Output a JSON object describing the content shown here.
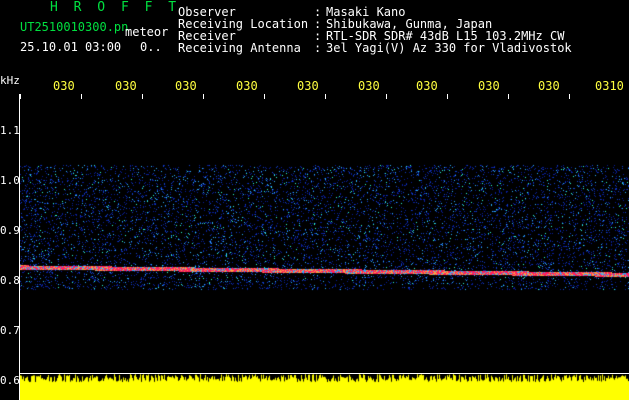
{
  "header": {
    "brand": "H R O F F T",
    "filename": "UT2510010300.pn",
    "meteor_label": "meteor",
    "datetime": "25.10.01 03:00",
    "count": "0..",
    "fields": [
      {
        "label": "Observer",
        "value": "Masaki Kano"
      },
      {
        "label": "Receiving Location",
        "value": "Shibukawa, Gunma, Japan"
      },
      {
        "label": "Receiver",
        "value": "RTL-SDR SDR# 43dB L15 103.2MHz CW"
      },
      {
        "label": "Receiving Antenna",
        "value": "3el Yagi(V) Az 330 for Vladivostok"
      }
    ]
  },
  "axis": {
    "unit": "kHz",
    "y_ticks": [
      "1.1",
      "1.0",
      "0.9",
      "0.8",
      "0.7",
      "0.6"
    ],
    "x_ticks": [
      "030",
      "030",
      "030",
      "030",
      "030",
      "030",
      "030",
      "030",
      "030",
      "0310"
    ]
  },
  "spectrogram": {
    "freq_range_khz": [
      0.6,
      1.15
    ],
    "signal_band_khz": [
      0.78,
      1.03
    ],
    "strong_line_khz": 0.825,
    "colors": {
      "background": "#000000",
      "low": "#0a1f9e",
      "mid": "#2fb0ff",
      "high": "#ff2060",
      "peak": "#ffd000",
      "power": "#ffff00"
    }
  }
}
